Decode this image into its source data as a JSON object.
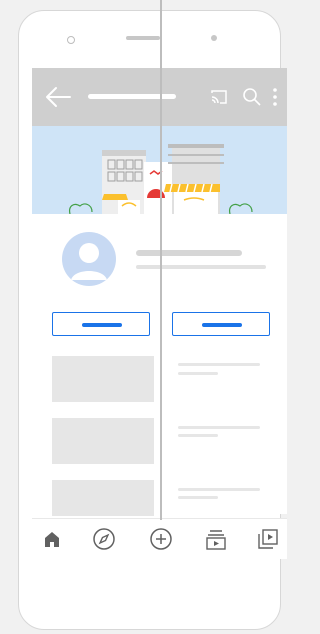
{
  "ui": {
    "accent": "#1a73e8",
    "appbar_color": "#cfcfcf",
    "banner_color": "#cfe4f7"
  },
  "appbar_icons": [
    "back-arrow-icon",
    "cast-icon",
    "search-icon",
    "more-vertical-icon"
  ],
  "bottom_nav_icons": [
    "home-icon",
    "explore-icon",
    "add-icon",
    "subscriptions-icon",
    "library-icon"
  ]
}
